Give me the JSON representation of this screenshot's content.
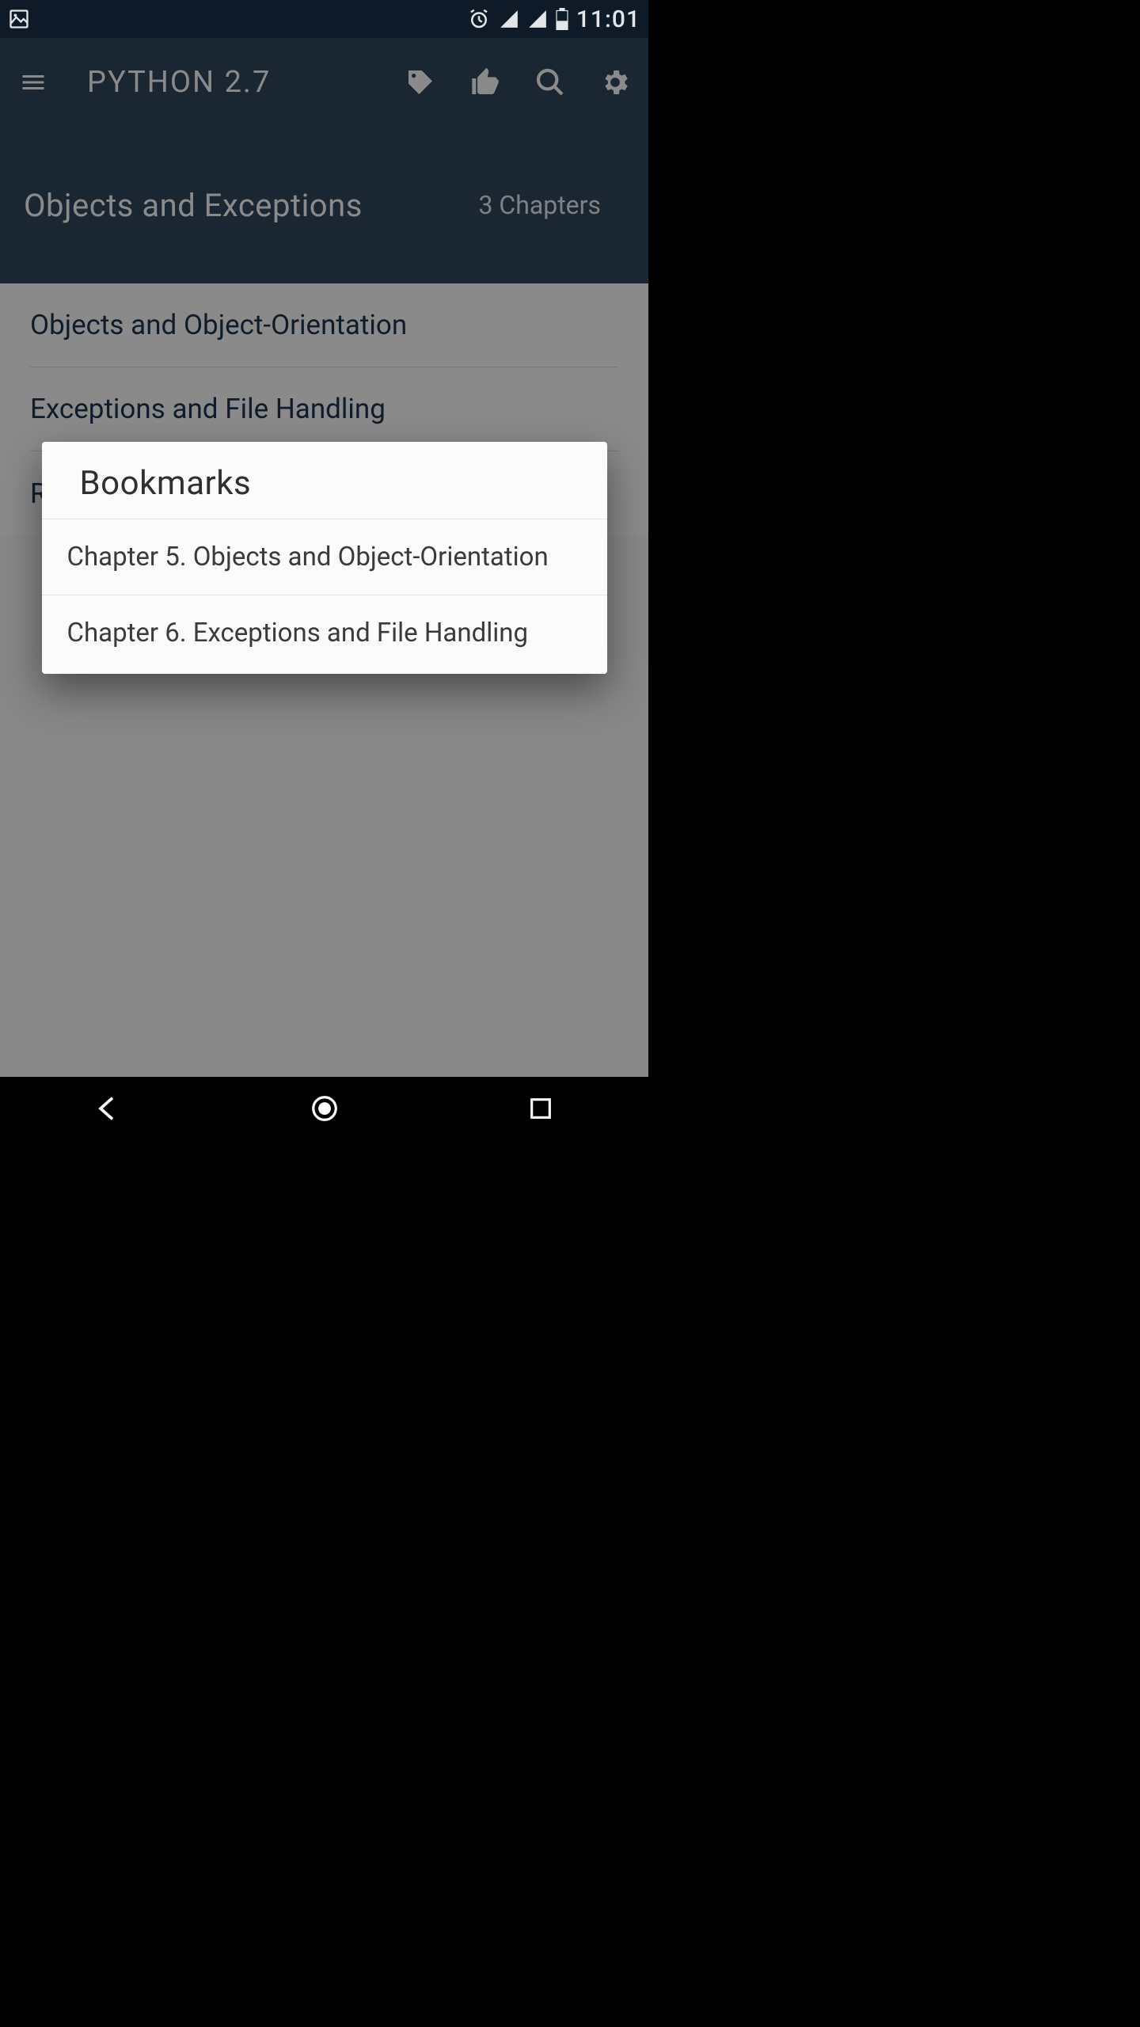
{
  "status": {
    "time": "11:01"
  },
  "toolbar": {
    "title": "PYTHON 2.7"
  },
  "section": {
    "title": "Objects and Exceptions",
    "count": "3 Chapters",
    "chapters": [
      "Objects and Object-Orientation",
      "Exceptions and File Handling",
      "Regular Expressions"
    ]
  },
  "dialog": {
    "title": "Bookmarks",
    "items": [
      "Chapter 5. Objects and Object-Orientation",
      "Chapter 6. Exceptions and File Handling"
    ]
  }
}
